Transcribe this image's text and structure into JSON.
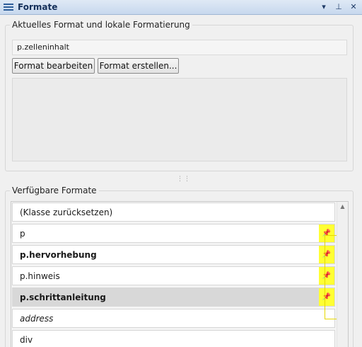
{
  "panel": {
    "title": "Formate",
    "controls": {
      "dropdown": "▾",
      "pin": "⊥",
      "close": "✕"
    }
  },
  "current": {
    "group_label": "Aktuelles Format und lokale Formatierung",
    "format_value": "p.zelleninhalt",
    "edit_button": "Format bearbeiten",
    "create_button": "Format erstellen..."
  },
  "available": {
    "group_label": "Verfügbare Formate",
    "items": [
      {
        "label": "(Klasse zurücksetzen)",
        "style": "normal",
        "pinned": false
      },
      {
        "label": "p",
        "style": "normal",
        "pinned": true
      },
      {
        "label": "p.hervorhebung",
        "style": "bold",
        "pinned": true
      },
      {
        "label": "p.hinweis",
        "style": "normal",
        "pinned": true
      },
      {
        "label": "p.schrittanleitung",
        "style": "bold",
        "pinned": true,
        "selected": true
      },
      {
        "label": "address",
        "style": "italic",
        "pinned": false
      },
      {
        "label": "div",
        "style": "normal",
        "pinned": false
      }
    ],
    "pin_glyph": "📌"
  },
  "colors": {
    "title_bar": "#c7d8ee",
    "pin_highlight": "#ffff33",
    "selected_row": "#d8d8d8"
  },
  "icons": [
    "menu-icon",
    "dropdown-arrow-icon",
    "pin-panel-icon",
    "close-icon",
    "pushpin-icon",
    "scroll-up-arrow-icon"
  ]
}
